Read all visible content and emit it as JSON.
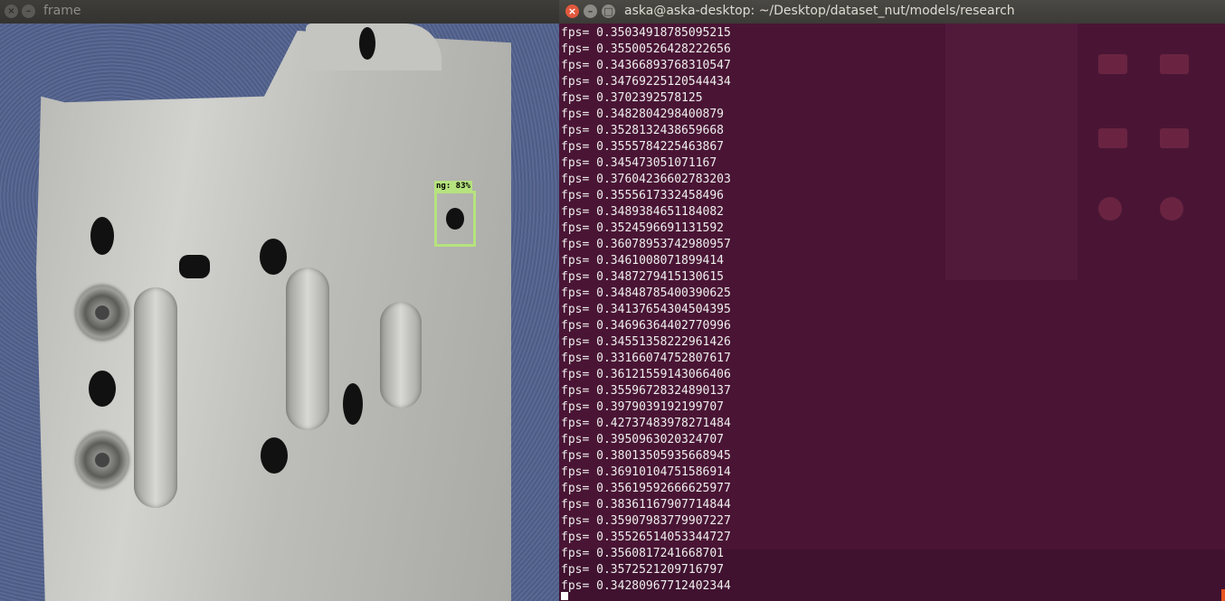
{
  "frame_window": {
    "title": "frame",
    "detection": {
      "label": "ng: 83%"
    }
  },
  "terminal_window": {
    "title": "aska@aska-desktop: ~/Desktop/dataset_nut/models/research",
    "lines": [
      "fps= 0.35034918785095215",
      "fps= 0.35500526428222656",
      "fps= 0.34366893768310547",
      "fps= 0.34769225120544434",
      "fps= 0.3702392578125",
      "fps= 0.3482804298400879",
      "fps= 0.3528132438659668",
      "fps= 0.3555784225463867",
      "fps= 0.345473051071167",
      "fps= 0.37604236602783203",
      "fps= 0.3555617332458496",
      "fps= 0.3489384651184082",
      "fps= 0.3524596691131592",
      "fps= 0.36078953742980957",
      "fps= 0.3461008071899414",
      "fps= 0.3487279415130615",
      "fps= 0.34848785400390625",
      "fps= 0.34137654304504395",
      "fps= 0.34696364402770996",
      "fps= 0.34551358222961426",
      "fps= 0.33166074752807617",
      "fps= 0.36121559143066406",
      "fps= 0.35596728324890137",
      "fps= 0.3979039192199707",
      "fps= 0.42737483978271484",
      "fps= 0.3950963020324707",
      "fps= 0.38013505935668945",
      "fps= 0.36910104751586914",
      "fps= 0.35619592666625977",
      "fps= 0.38361167907714844",
      "fps= 0.35907983779907227",
      "fps= 0.35526514053344727",
      "fps= 0.3560817241668701",
      "fps= 0.3572521209716797",
      "fps= 0.34280967712402344"
    ]
  },
  "colors": {
    "terminal_bg": "#4a1535",
    "terminal_text": "#eeeeec",
    "detection_box": "#b6e37e",
    "close_button": "#e2583d"
  }
}
